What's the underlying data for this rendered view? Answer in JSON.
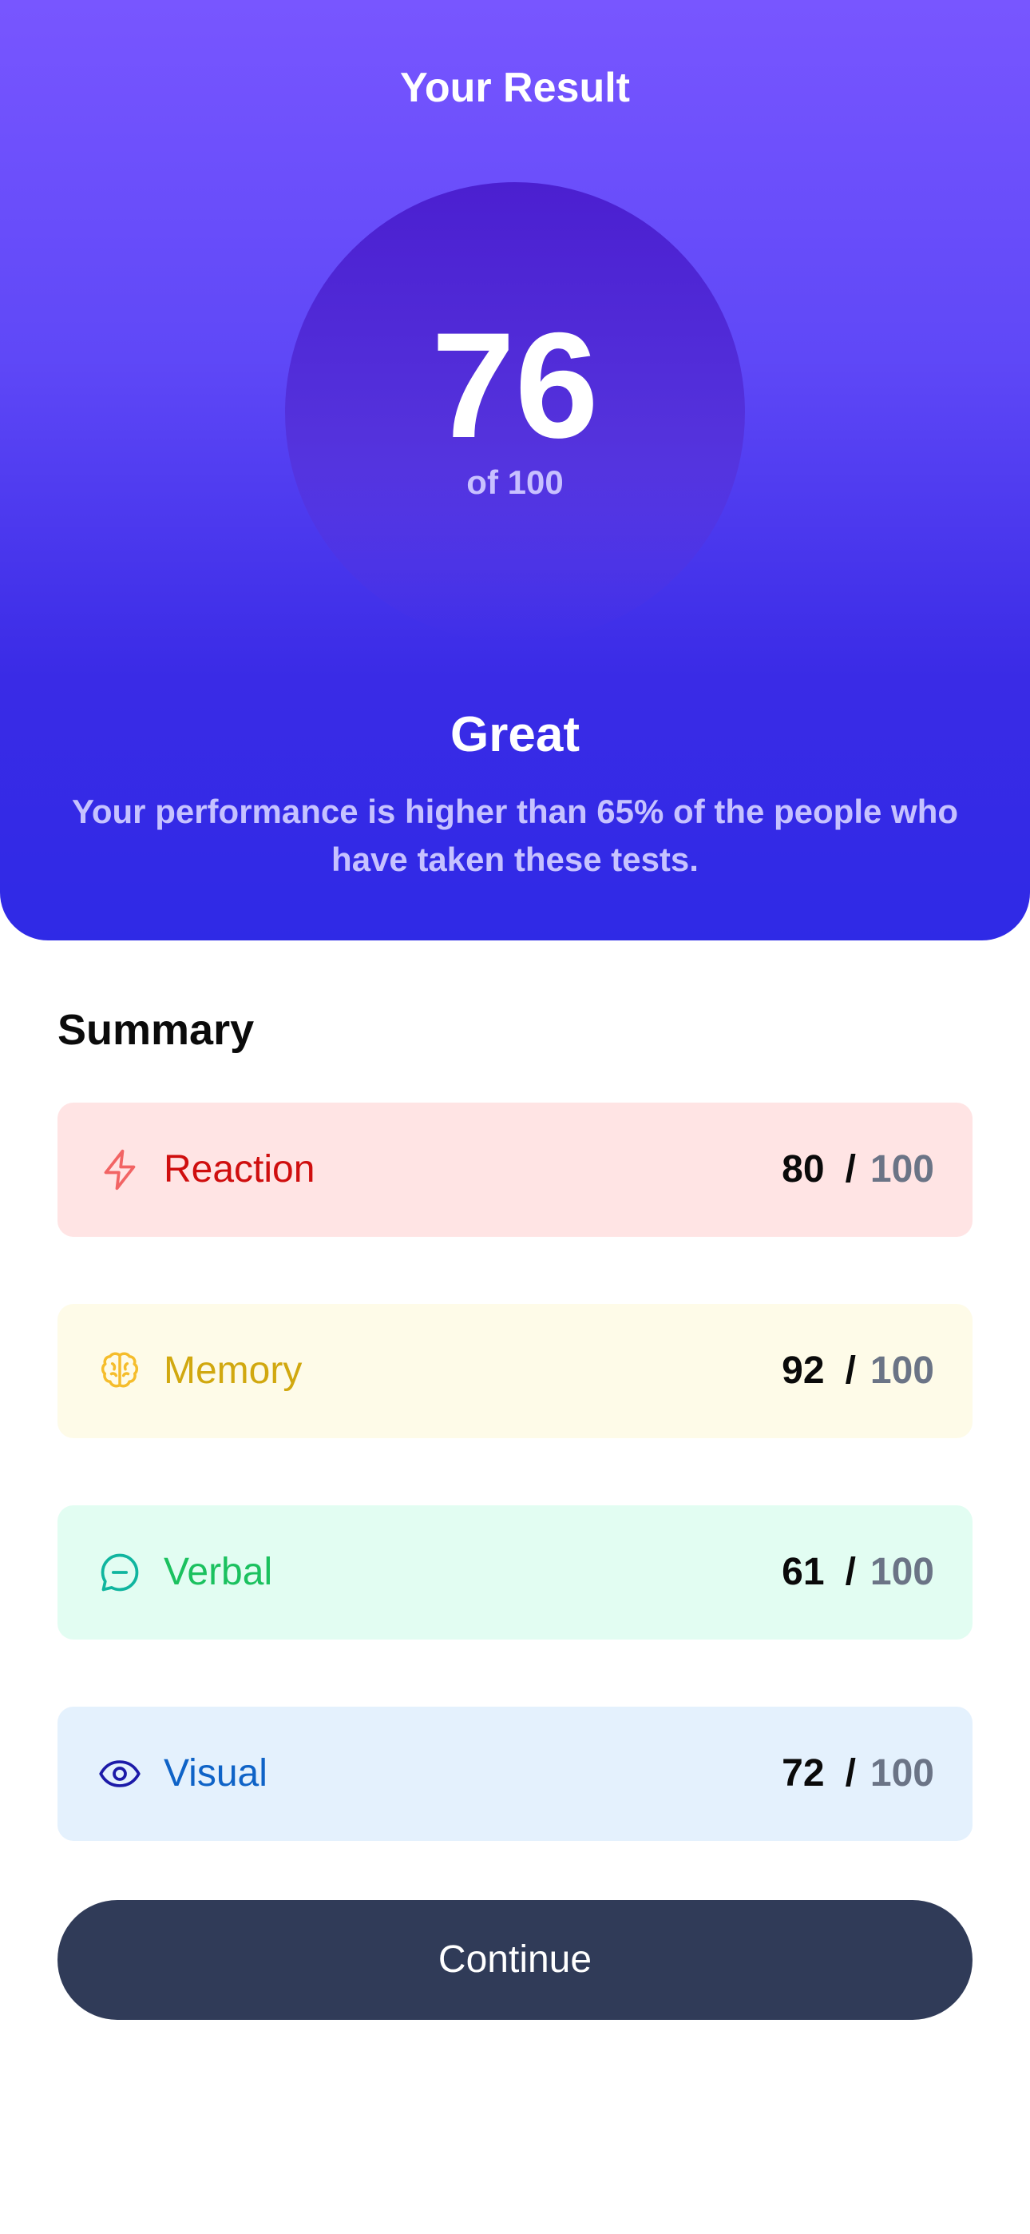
{
  "header": {
    "title": "Your Result"
  },
  "score": {
    "value": "76",
    "max_label": "of 100"
  },
  "grade": {
    "title": "Great",
    "description": "Your performance is higher than 65% of the people who have taken these tests."
  },
  "summary": {
    "title": "Summary",
    "items": [
      {
        "label": "Reaction",
        "score": "80",
        "separator": "/",
        "max": "100",
        "icon": "lightning-icon",
        "bg": "#ffe4e4",
        "label_color": "#cf0e0e",
        "icon_color": "#f26464"
      },
      {
        "label": "Memory",
        "score": "92",
        "separator": "/",
        "max": "100",
        "icon": "brain-icon",
        "bg": "#fefbe8",
        "label_color": "#d1a80f",
        "icon_color": "#f5bd2c"
      },
      {
        "label": "Verbal",
        "score": "61",
        "separator": "/",
        "max": "100",
        "icon": "chat-bubble-icon",
        "bg": "#e2fdf2",
        "label_color": "#1bc15f",
        "icon_color": "#10b59f"
      },
      {
        "label": "Visual",
        "score": "72",
        "separator": "/",
        "max": "100",
        "icon": "eye-icon",
        "bg": "#e4f1fd",
        "label_color": "#0f63c7",
        "icon_color": "#1c1aa8"
      }
    ]
  },
  "actions": {
    "continue_label": "Continue"
  }
}
